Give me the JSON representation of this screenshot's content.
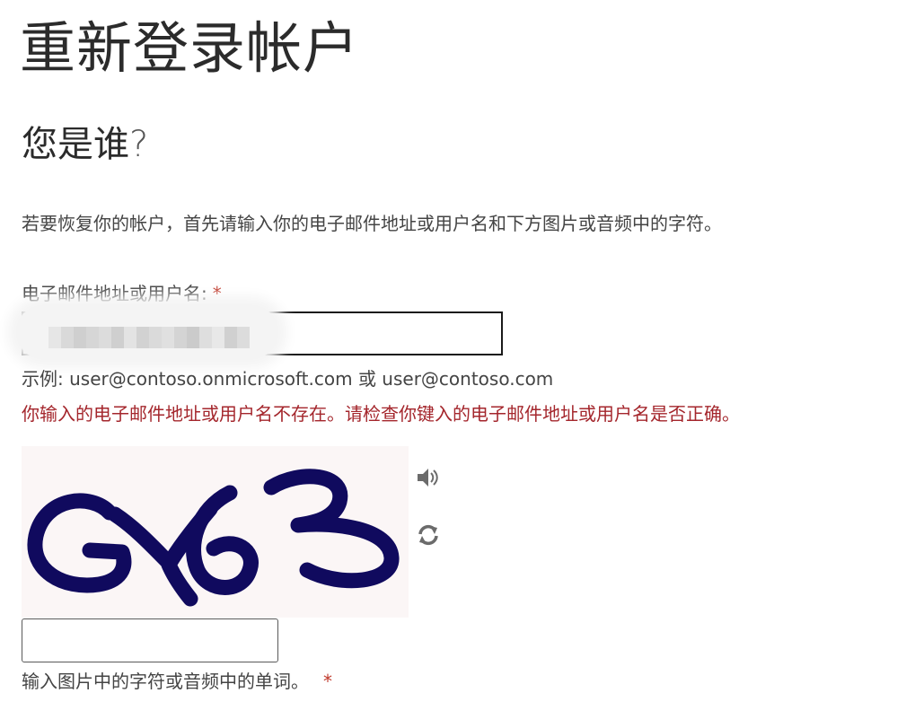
{
  "page": {
    "title": "重新登录帐户",
    "heading": "您是谁",
    "heading_mark": "?",
    "intro": "若要恢复你的帐户，首先请输入你的电子邮件地址或用户名和下方图片或音频中的字符。"
  },
  "email_field": {
    "label": "电子邮件地址或用户名:",
    "required_mark": "*",
    "value": "",
    "example": "示例: user@contoso.onmicrosoft.com 或 user@contoso.com",
    "error": "你输入的电子邮件地址或用户名不存在。请检查你键入的电子邮件地址或用户名是否正确。"
  },
  "captcha": {
    "characters": "GY63",
    "ink_color": "#100a5e",
    "background_color": "#fbf6f6",
    "audio_icon": "speaker-icon",
    "refresh_icon": "refresh-icon",
    "input_value": "",
    "hint": "输入图片中的字符或音频中的单词。",
    "required_mark": "*"
  },
  "colors": {
    "error": "#a4262c",
    "required": "#c0392b",
    "text": "#444444"
  }
}
